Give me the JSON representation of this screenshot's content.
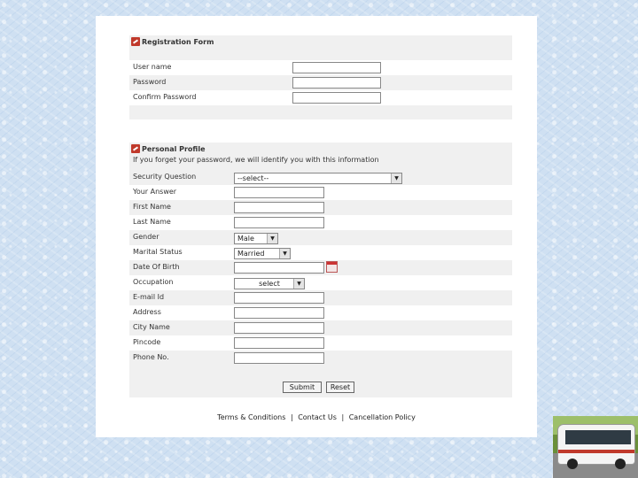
{
  "registration": {
    "title": "Registration Form",
    "fields": [
      {
        "label": "User name"
      },
      {
        "label": "Password"
      },
      {
        "label": "Confirm Password"
      }
    ]
  },
  "personal": {
    "title": "Personal Profile",
    "subtitle": "If you forget your password, we will identify you with this information",
    "security_label": "Security Question",
    "security_value": "--select--",
    "answer_label": "Your Answer",
    "first_name_label": "First Name",
    "last_name_label": "Last Name",
    "gender_label": "Gender",
    "gender_value": "Male",
    "marital_label": "Marital Status",
    "marital_value": "Married",
    "dob_label": "Date Of Birth",
    "occupation_label": "Occupation",
    "occupation_value": "select",
    "email_label": "E-mail Id",
    "address_label": "Address",
    "city_label": "City Name",
    "pincode_label": "Pincode",
    "phone_label": "Phone No."
  },
  "buttons": {
    "submit": "Submit",
    "reset": "Reset"
  },
  "footer": {
    "terms": "Terms & Conditions",
    "contact": "Contact Us",
    "separator": "|",
    "cancellation": "Cancellation Policy"
  },
  "icons": {
    "section": "section-flag-icon",
    "calendar": "calendar-icon",
    "dropdown": "chevron-down-icon"
  }
}
